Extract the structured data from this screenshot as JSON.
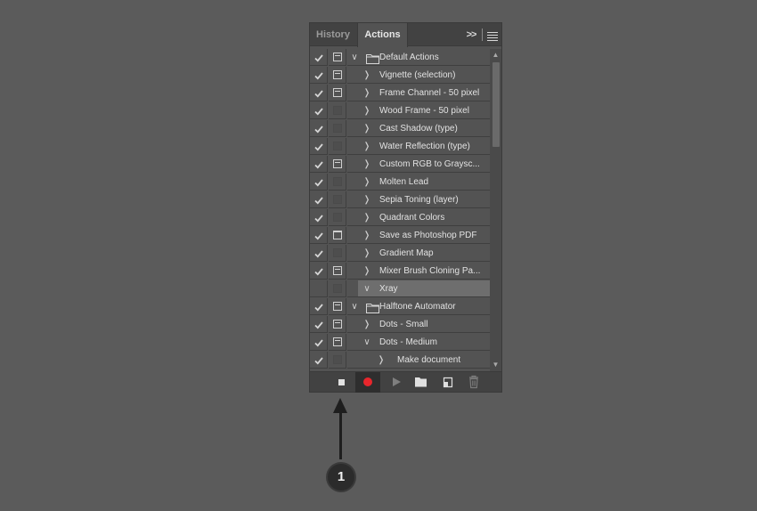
{
  "tabs": {
    "history": "History",
    "actions": "Actions"
  },
  "rows": [
    {
      "label": "Default Actions",
      "checked": true,
      "dialog": "box",
      "type": "folder",
      "expanded": true,
      "level": 0
    },
    {
      "label": "Vignette (selection)",
      "checked": true,
      "dialog": "box",
      "type": "action",
      "expanded": false,
      "level": 1
    },
    {
      "label": "Frame Channel - 50 pixel",
      "checked": true,
      "dialog": "box",
      "type": "action",
      "expanded": false,
      "level": 1
    },
    {
      "label": "Wood Frame - 50 pixel",
      "checked": true,
      "dialog": "none",
      "type": "action",
      "expanded": false,
      "level": 1
    },
    {
      "label": "Cast Shadow (type)",
      "checked": true,
      "dialog": "none",
      "type": "action",
      "expanded": false,
      "level": 1
    },
    {
      "label": "Water Reflection (type)",
      "checked": true,
      "dialog": "none",
      "type": "action",
      "expanded": false,
      "level": 1
    },
    {
      "label": "Custom RGB to Graysc...",
      "checked": true,
      "dialog": "box",
      "type": "action",
      "expanded": false,
      "level": 1
    },
    {
      "label": "Molten Lead",
      "checked": true,
      "dialog": "none",
      "type": "action",
      "expanded": false,
      "level": 1
    },
    {
      "label": "Sepia Toning (layer)",
      "checked": true,
      "dialog": "none",
      "type": "action",
      "expanded": false,
      "level": 1
    },
    {
      "label": "Quadrant Colors",
      "checked": true,
      "dialog": "none",
      "type": "action",
      "expanded": false,
      "level": 1
    },
    {
      "label": "Save as Photoshop PDF",
      "checked": true,
      "dialog": "simple",
      "type": "action",
      "expanded": false,
      "level": 1
    },
    {
      "label": "Gradient Map",
      "checked": true,
      "dialog": "none",
      "type": "action",
      "expanded": false,
      "level": 1
    },
    {
      "label": "Mixer Brush Cloning Pa...",
      "checked": true,
      "dialog": "box",
      "type": "action",
      "expanded": false,
      "level": 1
    },
    {
      "label": "Xray",
      "checked": false,
      "dialog": "none",
      "type": "action",
      "expanded": true,
      "level": 1,
      "selected": true
    },
    {
      "label": "Halftone Automator",
      "checked": true,
      "dialog": "box",
      "type": "folder",
      "expanded": true,
      "level": 0
    },
    {
      "label": "Dots - Small",
      "checked": true,
      "dialog": "box",
      "type": "action",
      "expanded": false,
      "level": 1
    },
    {
      "label": "Dots - Medium",
      "checked": true,
      "dialog": "box",
      "type": "action",
      "expanded": true,
      "level": 1
    },
    {
      "label": "Make document",
      "checked": true,
      "dialog": "none",
      "type": "step",
      "expanded": false,
      "level": 2
    }
  ],
  "bottom_buttons": [
    "stop-recording",
    "begin-recording",
    "play-selection",
    "create-new-set",
    "create-new-action",
    "delete"
  ],
  "callout": {
    "number": "1"
  }
}
